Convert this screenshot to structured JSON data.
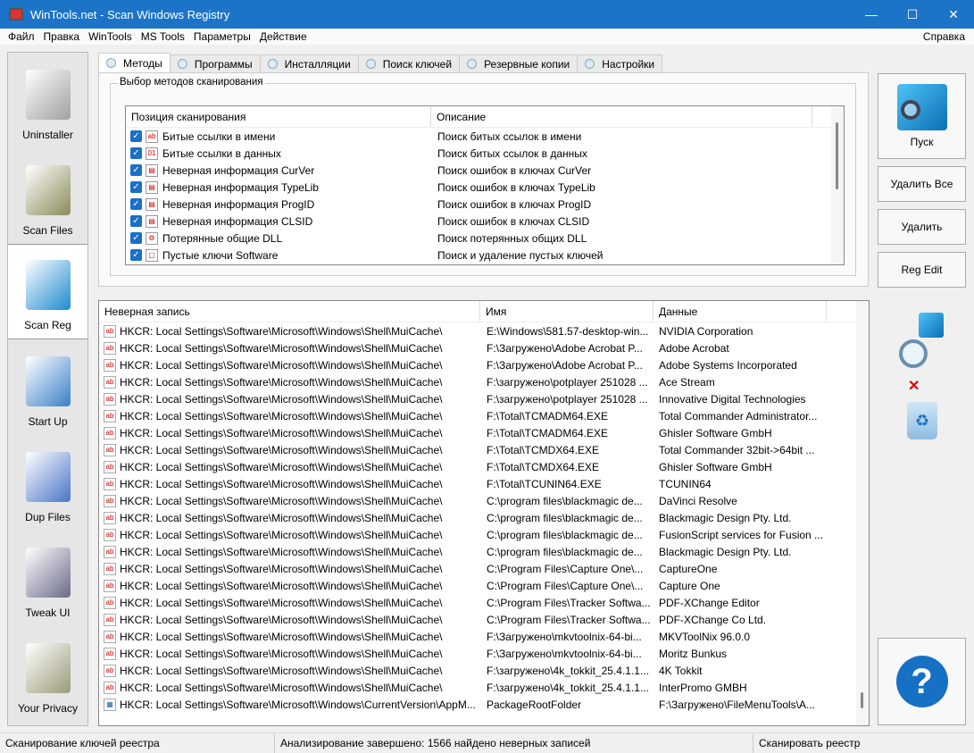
{
  "window": {
    "title": "WinTools.net - Scan Windows Registry"
  },
  "menu": [
    "Файл",
    "Правка",
    "WinTools",
    "MS Tools",
    "Параметры",
    "Действие"
  ],
  "menu_help": "Справка",
  "sidebar": [
    {
      "label": "Uninstaller",
      "color": "#a0a0a0"
    },
    {
      "label": "Scan Files",
      "color": "#8b8b5a"
    },
    {
      "label": "Scan Reg",
      "color": "#1e8bd0"
    },
    {
      "label": "Start Up",
      "color": "#3a7fc9"
    },
    {
      "label": "Dup Files",
      "color": "#4a74c9"
    },
    {
      "label": "Tweak UI",
      "color": "#6a6a8a"
    },
    {
      "label": "Your Privacy",
      "color": "#9a9a7a"
    }
  ],
  "tabs": [
    "Методы",
    "Программы",
    "Инсталляции",
    "Поиск ключей",
    "Резервные копии",
    "Настройки"
  ],
  "methods": {
    "group_title": "Выбор методов сканирования",
    "col1": "Позиция сканирования",
    "col2": "Описание",
    "rows": [
      {
        "name": "Битые ссылки в имени",
        "desc": "Поиск битых ссылок в имени"
      },
      {
        "name": "Битые ссылки в данных",
        "desc": "Поиск битых ссылок в данных"
      },
      {
        "name": "Неверная информация CurVer",
        "desc": "Поиск ошибок в ключах CurVer"
      },
      {
        "name": "Неверная информация TypeLib",
        "desc": "Поиск ошибок в ключах TypeLib"
      },
      {
        "name": "Неверная информация ProgID",
        "desc": "Поиск ошибок в ключах ProgID"
      },
      {
        "name": "Неверная информация CLSID",
        "desc": "Поиск ошибок в ключах CLSID"
      },
      {
        "name": "Потерянные общие DLL",
        "desc": "Поиск потерянных общих DLL"
      },
      {
        "name": "Пустые ключи Software",
        "desc": "Поиск и удаление пустых ключей"
      }
    ]
  },
  "results": {
    "col1": "Неверная запись",
    "col2": "Имя",
    "col3": "Данные",
    "rows": [
      [
        "HKCR: Local Settings\\Software\\Microsoft\\Windows\\Shell\\MuiCache\\",
        "E:\\Windows\\581.57-desktop-win...",
        "NVIDIA Corporation"
      ],
      [
        "HKCR: Local Settings\\Software\\Microsoft\\Windows\\Shell\\MuiCache\\",
        "F:\\Загружено\\Adobe Acrobat P...",
        "Adobe Acrobat"
      ],
      [
        "HKCR: Local Settings\\Software\\Microsoft\\Windows\\Shell\\MuiCache\\",
        "F:\\Загружено\\Adobe Acrobat P...",
        "Adobe Systems Incorporated"
      ],
      [
        "HKCR: Local Settings\\Software\\Microsoft\\Windows\\Shell\\MuiCache\\",
        "F:\\загружено\\potplayer 251028 ...",
        "Ace Stream"
      ],
      [
        "HKCR: Local Settings\\Software\\Microsoft\\Windows\\Shell\\MuiCache\\",
        "F:\\загружено\\potplayer 251028 ...",
        "Innovative Digital Technologies"
      ],
      [
        "HKCR: Local Settings\\Software\\Microsoft\\Windows\\Shell\\MuiCache\\",
        "F:\\Total\\TCMADM64.EXE",
        "Total Commander Administrator..."
      ],
      [
        "HKCR: Local Settings\\Software\\Microsoft\\Windows\\Shell\\MuiCache\\",
        "F:\\Total\\TCMADM64.EXE",
        "Ghisler Software GmbH"
      ],
      [
        "HKCR: Local Settings\\Software\\Microsoft\\Windows\\Shell\\MuiCache\\",
        "F:\\Total\\TCMDX64.EXE",
        "Total Commander 32bit->64bit ..."
      ],
      [
        "HKCR: Local Settings\\Software\\Microsoft\\Windows\\Shell\\MuiCache\\",
        "F:\\Total\\TCMDX64.EXE",
        "Ghisler Software GmbH"
      ],
      [
        "HKCR: Local Settings\\Software\\Microsoft\\Windows\\Shell\\MuiCache\\",
        "F:\\Total\\TCUNIN64.EXE",
        "TCUNIN64"
      ],
      [
        "HKCR: Local Settings\\Software\\Microsoft\\Windows\\Shell\\MuiCache\\",
        "C:\\program files\\blackmagic de...",
        "DaVinci Resolve"
      ],
      [
        "HKCR: Local Settings\\Software\\Microsoft\\Windows\\Shell\\MuiCache\\",
        "C:\\program files\\blackmagic de...",
        "Blackmagic Design Pty. Ltd."
      ],
      [
        "HKCR: Local Settings\\Software\\Microsoft\\Windows\\Shell\\MuiCache\\",
        "C:\\program files\\blackmagic de...",
        "FusionScript services for Fusion ..."
      ],
      [
        "HKCR: Local Settings\\Software\\Microsoft\\Windows\\Shell\\MuiCache\\",
        "C:\\program files\\blackmagic de...",
        "Blackmagic Design Pty. Ltd."
      ],
      [
        "HKCR: Local Settings\\Software\\Microsoft\\Windows\\Shell\\MuiCache\\",
        "C:\\Program Files\\Capture One\\...",
        "CaptureOne"
      ],
      [
        "HKCR: Local Settings\\Software\\Microsoft\\Windows\\Shell\\MuiCache\\",
        "C:\\Program Files\\Capture One\\...",
        "Capture One"
      ],
      [
        "HKCR: Local Settings\\Software\\Microsoft\\Windows\\Shell\\MuiCache\\",
        "C:\\Program Files\\Tracker Softwa...",
        "PDF-XChange Editor"
      ],
      [
        "HKCR: Local Settings\\Software\\Microsoft\\Windows\\Shell\\MuiCache\\",
        "C:\\Program Files\\Tracker Softwa...",
        "PDF-XChange Co Ltd."
      ],
      [
        "HKCR: Local Settings\\Software\\Microsoft\\Windows\\Shell\\MuiCache\\",
        "F:\\Загружено\\mkvtoolnix-64-bi...",
        "MKVToolNix 96.0.0"
      ],
      [
        "HKCR: Local Settings\\Software\\Microsoft\\Windows\\Shell\\MuiCache\\",
        "F:\\Загружено\\mkvtoolnix-64-bi...",
        "Moritz Bunkus"
      ],
      [
        "HKCR: Local Settings\\Software\\Microsoft\\Windows\\Shell\\MuiCache\\",
        "F:\\загружено\\4k_tokkit_25.4.1.1...",
        "4K Tokkit"
      ],
      [
        "HKCR: Local Settings\\Software\\Microsoft\\Windows\\Shell\\MuiCache\\",
        "F:\\загружено\\4k_tokkit_25.4.1.1...",
        "InterPromo GMBH"
      ],
      [
        "HKCR: Local Settings\\Software\\Microsoft\\Windows\\CurrentVersion\\AppM...",
        "PackageRootFolder",
        "F:\\Загружено\\FileMenuTools\\A..."
      ]
    ]
  },
  "buttons": {
    "start": "Пуск",
    "delete_all": "Удалить Все",
    "delete": "Удалить",
    "reg_edit": "Reg Edit",
    "help": "?"
  },
  "status": {
    "left": "Сканирование ключей реестра",
    "middle": "Анализирование завершено: 1566 найдено неверных записей",
    "right": "Сканировать реестр"
  }
}
